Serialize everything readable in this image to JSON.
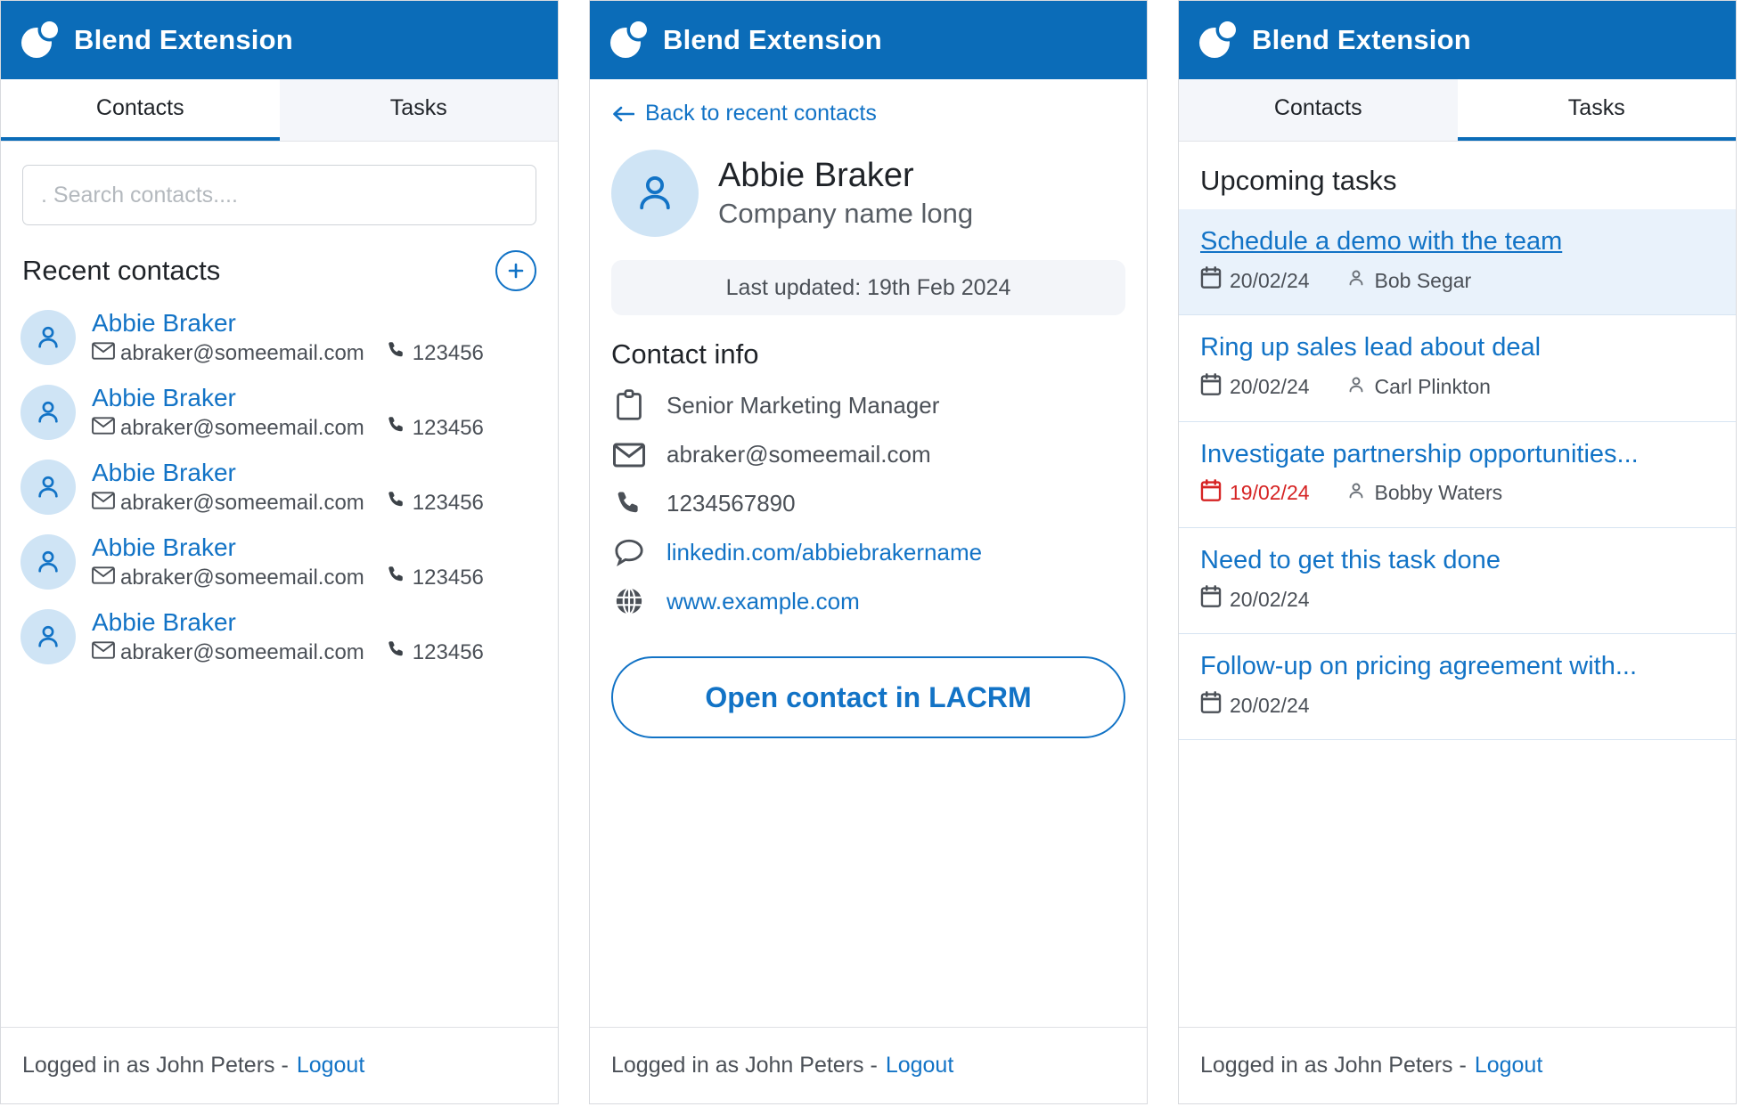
{
  "app": {
    "title": "Blend Extension",
    "brand_color": "#0b6cb8",
    "link_color": "#1273c6",
    "overdue_color": "#d62424",
    "logo_icon": "blend-logo-icon"
  },
  "tabs": {
    "contacts": "Contacts",
    "tasks": "Tasks"
  },
  "footer": {
    "text": "Logged in as John Peters -",
    "logout": "Logout"
  },
  "panel_contacts": {
    "active_tab": "Contacts",
    "search": {
      "placeholder": ". Search contacts....",
      "value": ""
    },
    "section_title": "Recent contacts",
    "add_button_icon": "plus-circle-icon",
    "contacts": [
      {
        "name": "Abbie Braker",
        "email": "abraker@someemail.com",
        "phone": "123456"
      },
      {
        "name": "Abbie Braker",
        "email": "abraker@someemail.com",
        "phone": "123456"
      },
      {
        "name": "Abbie Braker",
        "email": "abraker@someemail.com",
        "phone": "123456"
      },
      {
        "name": "Abbie Braker",
        "email": "abraker@someemail.com",
        "phone": "123456"
      },
      {
        "name": "Abbie Braker",
        "email": "abraker@someemail.com",
        "phone": "123456"
      }
    ]
  },
  "panel_detail": {
    "back_label": "Back to recent contacts",
    "name": "Abbie Braker",
    "company": "Company name long",
    "last_updated": "Last updated: 19th Feb 2024",
    "section_title": "Contact info",
    "info": [
      {
        "icon": "clipboard-icon",
        "text": "Senior Marketing Manager",
        "is_link": false
      },
      {
        "icon": "envelope-icon",
        "text": "abraker@someemail.com",
        "is_link": false
      },
      {
        "icon": "phone-icon",
        "text": "1234567890",
        "is_link": false
      },
      {
        "icon": "chat-bubble-icon",
        "text": "linkedin.com/abbiebrakername",
        "is_link": true
      },
      {
        "icon": "globe-icon",
        "text": "www.example.com",
        "is_link": true
      }
    ],
    "open_button": "Open contact in LACRM"
  },
  "panel_tasks": {
    "active_tab": "Tasks",
    "section_title": "Upcoming tasks",
    "tasks": [
      {
        "name": "Schedule a demo with the team",
        "date": "20/02/24",
        "assignee": "Bob Segar",
        "overdue": false,
        "highlighted": true
      },
      {
        "name": "Ring up sales lead about deal",
        "date": "20/02/24",
        "assignee": "Carl Plinkton",
        "overdue": false,
        "highlighted": false
      },
      {
        "name": "Investigate partnership opportunities...",
        "date": "19/02/24",
        "assignee": "Bobby Waters",
        "overdue": true,
        "highlighted": false
      },
      {
        "name": "Need to get this task done",
        "date": "20/02/24",
        "assignee": "",
        "overdue": false,
        "highlighted": false
      },
      {
        "name": "Follow-up on pricing agreement with...",
        "date": "20/02/24",
        "assignee": "",
        "overdue": false,
        "highlighted": false
      }
    ]
  }
}
